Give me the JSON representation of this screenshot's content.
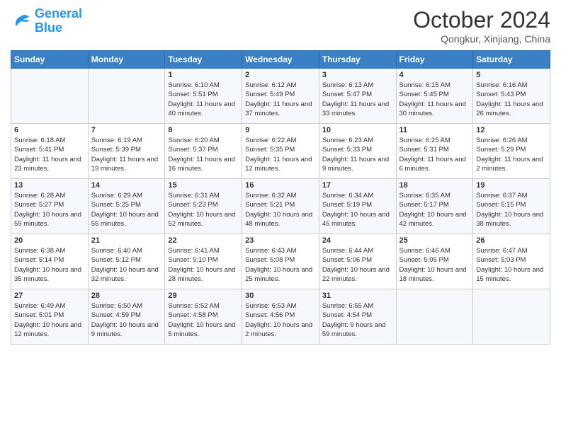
{
  "header": {
    "logo_general": "General",
    "logo_blue": "Blue",
    "month": "October 2024",
    "location": "Qongkur, Xinjiang, China"
  },
  "columns": [
    "Sunday",
    "Monday",
    "Tuesday",
    "Wednesday",
    "Thursday",
    "Friday",
    "Saturday"
  ],
  "rows": [
    [
      {
        "day": "",
        "info": ""
      },
      {
        "day": "",
        "info": ""
      },
      {
        "day": "1",
        "info": "Sunrise: 6:10 AM\nSunset: 5:51 PM\nDaylight: 11 hours and 40 minutes."
      },
      {
        "day": "2",
        "info": "Sunrise: 6:12 AM\nSunset: 5:49 PM\nDaylight: 11 hours and 37 minutes."
      },
      {
        "day": "3",
        "info": "Sunrise: 6:13 AM\nSunset: 5:47 PM\nDaylight: 11 hours and 33 minutes."
      },
      {
        "day": "4",
        "info": "Sunrise: 6:15 AM\nSunset: 5:45 PM\nDaylight: 11 hours and 30 minutes."
      },
      {
        "day": "5",
        "info": "Sunrise: 6:16 AM\nSunset: 5:43 PM\nDaylight: 11 hours and 26 minutes."
      }
    ],
    [
      {
        "day": "6",
        "info": "Sunrise: 6:18 AM\nSunset: 5:41 PM\nDaylight: 11 hours and 23 minutes."
      },
      {
        "day": "7",
        "info": "Sunrise: 6:19 AM\nSunset: 5:39 PM\nDaylight: 11 hours and 19 minutes."
      },
      {
        "day": "8",
        "info": "Sunrise: 6:20 AM\nSunset: 5:37 PM\nDaylight: 11 hours and 16 minutes."
      },
      {
        "day": "9",
        "info": "Sunrise: 6:22 AM\nSunset: 5:35 PM\nDaylight: 11 hours and 12 minutes."
      },
      {
        "day": "10",
        "info": "Sunrise: 6:23 AM\nSunset: 5:33 PM\nDaylight: 11 hours and 9 minutes."
      },
      {
        "day": "11",
        "info": "Sunrise: 6:25 AM\nSunset: 5:31 PM\nDaylight: 11 hours and 6 minutes."
      },
      {
        "day": "12",
        "info": "Sunrise: 6:26 AM\nSunset: 5:29 PM\nDaylight: 11 hours and 2 minutes."
      }
    ],
    [
      {
        "day": "13",
        "info": "Sunrise: 6:28 AM\nSunset: 5:27 PM\nDaylight: 10 hours and 59 minutes."
      },
      {
        "day": "14",
        "info": "Sunrise: 6:29 AM\nSunset: 5:25 PM\nDaylight: 10 hours and 55 minutes."
      },
      {
        "day": "15",
        "info": "Sunrise: 6:31 AM\nSunset: 5:23 PM\nDaylight: 10 hours and 52 minutes."
      },
      {
        "day": "16",
        "info": "Sunrise: 6:32 AM\nSunset: 5:21 PM\nDaylight: 10 hours and 48 minutes."
      },
      {
        "day": "17",
        "info": "Sunrise: 6:34 AM\nSunset: 5:19 PM\nDaylight: 10 hours and 45 minutes."
      },
      {
        "day": "18",
        "info": "Sunrise: 6:35 AM\nSunset: 5:17 PM\nDaylight: 10 hours and 42 minutes."
      },
      {
        "day": "19",
        "info": "Sunrise: 6:37 AM\nSunset: 5:15 PM\nDaylight: 10 hours and 38 minutes."
      }
    ],
    [
      {
        "day": "20",
        "info": "Sunrise: 6:38 AM\nSunset: 5:14 PM\nDaylight: 10 hours and 35 minutes."
      },
      {
        "day": "21",
        "info": "Sunrise: 6:40 AM\nSunset: 5:12 PM\nDaylight: 10 hours and 32 minutes."
      },
      {
        "day": "22",
        "info": "Sunrise: 6:41 AM\nSunset: 5:10 PM\nDaylight: 10 hours and 28 minutes."
      },
      {
        "day": "23",
        "info": "Sunrise: 6:43 AM\nSunset: 5:08 PM\nDaylight: 10 hours and 25 minutes."
      },
      {
        "day": "24",
        "info": "Sunrise: 6:44 AM\nSunset: 5:06 PM\nDaylight: 10 hours and 22 minutes."
      },
      {
        "day": "25",
        "info": "Sunrise: 6:46 AM\nSunset: 5:05 PM\nDaylight: 10 hours and 18 minutes."
      },
      {
        "day": "26",
        "info": "Sunrise: 6:47 AM\nSunset: 5:03 PM\nDaylight: 10 hours and 15 minutes."
      }
    ],
    [
      {
        "day": "27",
        "info": "Sunrise: 6:49 AM\nSunset: 5:01 PM\nDaylight: 10 hours and 12 minutes."
      },
      {
        "day": "28",
        "info": "Sunrise: 6:50 AM\nSunset: 4:59 PM\nDaylight: 10 hours and 9 minutes."
      },
      {
        "day": "29",
        "info": "Sunrise: 6:52 AM\nSunset: 4:58 PM\nDaylight: 10 hours and 5 minutes."
      },
      {
        "day": "30",
        "info": "Sunrise: 6:53 AM\nSunset: 4:56 PM\nDaylight: 10 hours and 2 minutes."
      },
      {
        "day": "31",
        "info": "Sunrise: 6:55 AM\nSunset: 4:54 PM\nDaylight: 9 hours and 59 minutes."
      },
      {
        "day": "",
        "info": ""
      },
      {
        "day": "",
        "info": ""
      }
    ]
  ]
}
